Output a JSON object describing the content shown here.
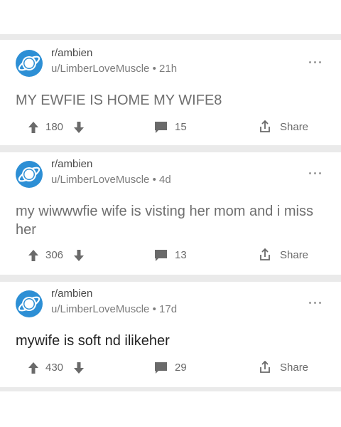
{
  "posts": [
    {
      "subreddit": "r/ambien",
      "user": "u/LimberLoveMuscle",
      "time": "21h",
      "title": "MY EWFIE IS HOME MY WIFE8",
      "upvotes": "180",
      "comments": "15",
      "share_label": "Share"
    },
    {
      "subreddit": "r/ambien",
      "user": "u/LimberLoveMuscle",
      "time": "4d",
      "title": "my wiwwwfie wife is visting her mom and i miss her",
      "upvotes": "306",
      "comments": "13",
      "share_label": "Share"
    },
    {
      "subreddit": "r/ambien",
      "user": "u/LimberLoveMuscle",
      "time": "17d",
      "title": "mywife is soft nd ilikeher",
      "upvotes": "430",
      "comments": "29",
      "share_label": "Share"
    }
  ],
  "separator": "•",
  "colors": {
    "avatar": "#2d8fd5",
    "divider": "#eaeaea",
    "icon": "#6a6a6a"
  },
  "icons": [
    "planet-icon",
    "more-icon",
    "upvote-icon",
    "downvote-icon",
    "comment-icon",
    "share-icon"
  ]
}
